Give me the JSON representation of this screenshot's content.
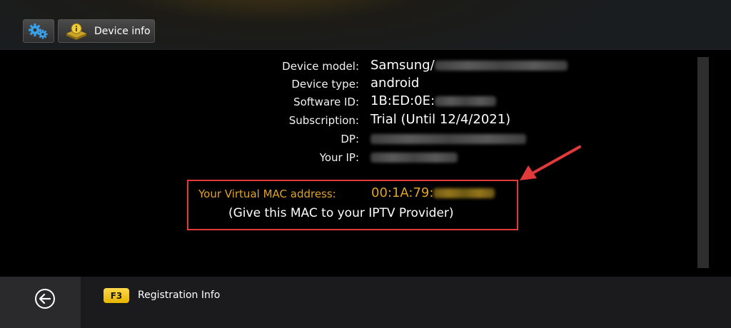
{
  "header": {
    "settings_icon": "gears-icon",
    "device_info_icon": "device-info-icon",
    "device_info_label": "Device info"
  },
  "device_info": {
    "rows": [
      {
        "label": "Device model:",
        "value": "Samsung/",
        "blurred": true
      },
      {
        "label": "Device type:",
        "value": "android",
        "blurred": false
      },
      {
        "label": "Software ID:",
        "value": "1B:ED:0E:",
        "blurred": true
      },
      {
        "label": "Subscription:",
        "value": "Trial (Until 12/4/2021)",
        "blurred": false
      },
      {
        "label": "DP:",
        "value": "",
        "blurred": true
      },
      {
        "label": "Your IP:",
        "value": "",
        "blurred": true
      }
    ],
    "mac": {
      "label": "Your Virtual MAC address:",
      "value": "00:1A:79:",
      "hint": "(Give this MAC to your IPTV Provider)"
    }
  },
  "footer": {
    "back_icon": "back-arrow-icon",
    "f3_key": "F3",
    "f3_label": "Registration Info"
  },
  "colors": {
    "accent_gold": "#e0a323",
    "highlight_red": "#e23a3a",
    "f3_yellow": "#ffd84a"
  }
}
